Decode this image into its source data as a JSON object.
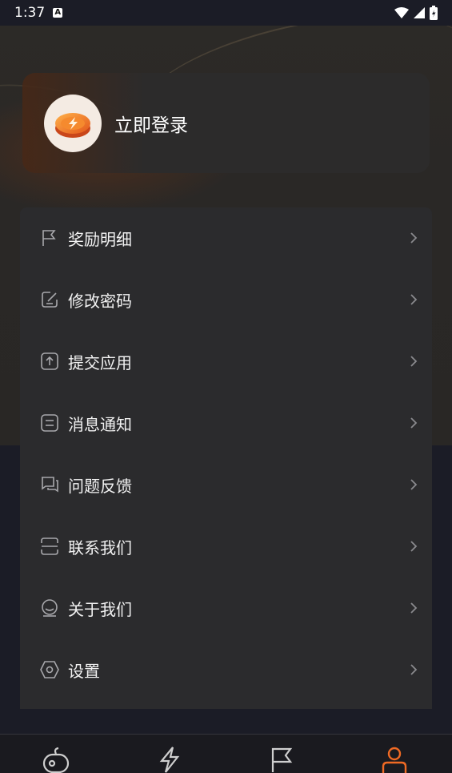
{
  "status_bar": {
    "time": "1:37",
    "notification_badge": "A",
    "icons": [
      "wifi-icon",
      "cellular-icon",
      "battery-icon"
    ]
  },
  "login_card": {
    "avatar_icon": "coin-lightning-icon",
    "login_label": "立即登录"
  },
  "menu": {
    "items": [
      {
        "label": "奖励明细",
        "icon": "flag-icon"
      },
      {
        "label": "修改密码",
        "icon": "edit-icon"
      },
      {
        "label": "提交应用",
        "icon": "upload-icon"
      },
      {
        "label": "消息通知",
        "icon": "message-icon"
      },
      {
        "label": "问题反馈",
        "icon": "chat-icon"
      },
      {
        "label": "联系我们",
        "icon": "scan-icon"
      },
      {
        "label": "关于我们",
        "icon": "about-icon"
      },
      {
        "label": "设置",
        "icon": "settings-icon"
      }
    ]
  },
  "bottom_nav": {
    "tabs": [
      {
        "icon": "gamepad-icon",
        "active": false
      },
      {
        "icon": "lightning-icon",
        "active": false
      },
      {
        "icon": "flag-icon",
        "active": false
      },
      {
        "icon": "user-icon",
        "active": true
      }
    ],
    "active_color": "#f06a24",
    "inactive_color": "#cfcfcf"
  },
  "colors": {
    "accent": "#f06a24",
    "menu_card": "#2b2b2d",
    "background": "#1b1c26"
  }
}
